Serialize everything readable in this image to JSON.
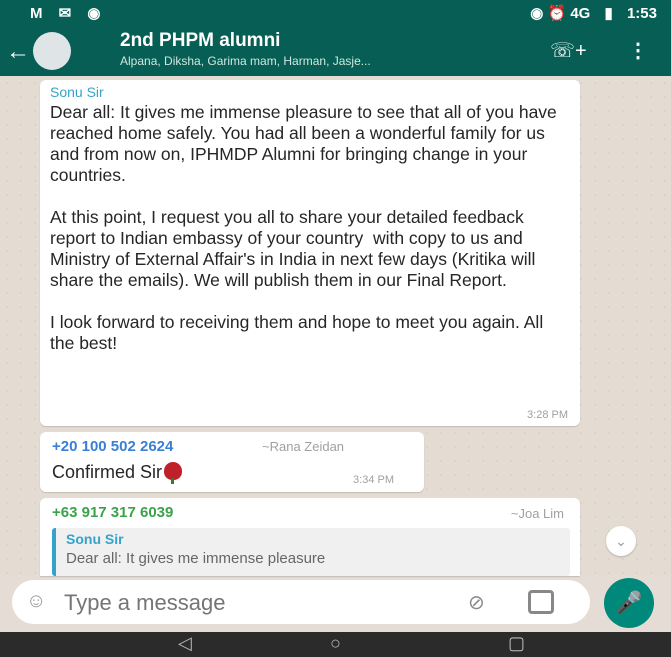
{
  "status_bar": {
    "left_icons": "M ✉ ◉",
    "signal_icons": "◉ ⏰ 4G",
    "time": "1:53"
  },
  "header": {
    "title": "2nd PHPM alumni",
    "subtitle": "Alpana, Diksha, Garima mam, Harman, Jasje...",
    "icons": [
      "back-arrow-icon",
      "add-call-icon",
      "more-options-icon"
    ]
  },
  "messages": [
    {
      "sender": "Sonu Sir",
      "text": "Dear all: It gives me immense pleasure to see that all of you have reached home safely. You had all been a wonderful family for us and from now on, IPHMDP Alumni for bringing change in your countries.\n\nAt this point, I request you all to share your detailed feedback report to Indian embassy of your country  with copy to us and Ministry of External Affair's in India in next few days (Kritika will share the emails). We will publish them in our Final Report.\n\nI look forward to receiving them and hope to meet you again. All the best!",
      "time": "3:28 PM"
    },
    {
      "number": "+20 100 502 2624",
      "name": "~Rana Zeidan",
      "text": "Confirmed Sir",
      "time": "3:34 PM"
    },
    {
      "number": "+63 917 317 6039",
      "name": "~Joa Lim",
      "quoted_sender": "Sonu Sir",
      "quoted_text": "Dear all: It gives me immense pleasure"
    }
  ],
  "input": {
    "placeholder": "Type a message"
  },
  "colors": {
    "header": "#075e54",
    "accent": "#00897b",
    "sender_blue": "#35a3c9",
    "number_green": "#3aa34a"
  }
}
